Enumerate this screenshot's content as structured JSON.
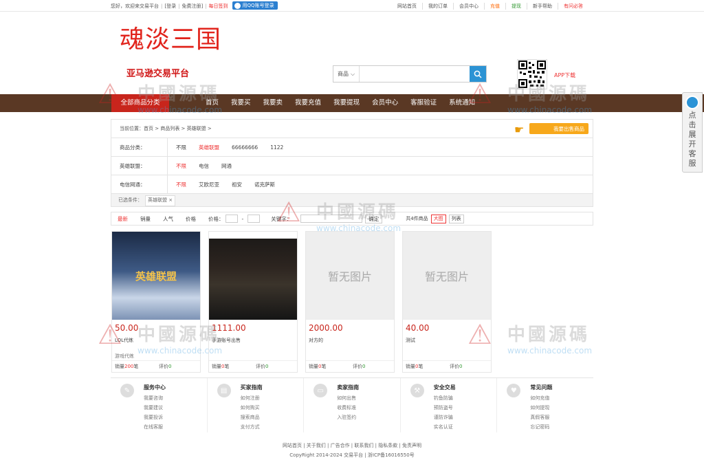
{
  "topbar": {
    "welcome": "您好，欢迎来交易平台",
    "login": "[登录",
    "register": "免费注册]",
    "signin": "每日签到",
    "qq_login": "用QQ账号登录",
    "links": [
      "网站首页",
      "我的订单",
      "会员中心",
      "充值",
      "提现",
      "新手帮助",
      "有问必答"
    ]
  },
  "brand": {
    "logo": "魂淡三国",
    "slogan": "亚马逊交易平台",
    "app_download": "APP下载"
  },
  "search": {
    "select_label": "商品",
    "placeholder": ""
  },
  "nav": {
    "items": [
      "全部商品分类",
      "首页",
      "我要买",
      "我要卖",
      "我要充值",
      "我要提现",
      "会员中心",
      "客服验证",
      "系统通知"
    ]
  },
  "crumb": {
    "text": "当前位置：首页 > 商品列表 > 英雄联盟 >",
    "sell_btn": "我要出售商品"
  },
  "filters": [
    {
      "label": "商品分类：",
      "values": [
        "不限",
        "英雄联盟",
        "66666666",
        "1122"
      ],
      "active": 1
    },
    {
      "label": "英雄联盟：",
      "values": [
        "不限",
        "电信",
        "网通"
      ],
      "active": 0
    },
    {
      "label": "电信网通：",
      "values": [
        "不限",
        "艾欧尼亚",
        "祖安",
        "诺克萨斯"
      ],
      "active": 0
    }
  ],
  "chosen": {
    "label": "已选条件：",
    "tag": "英雄联盟 ×"
  },
  "sort": {
    "items": [
      "最新",
      "销量",
      "人气",
      "价格"
    ],
    "price_label": "价格：",
    "dash": "-",
    "keyword_label": "关键字：",
    "confirm": "确定",
    "total_label": "共4件商品",
    "view_grid": "大图",
    "view_list": "列表"
  },
  "products": [
    {
      "price": "50.00",
      "title": "LOL代练",
      "sub": "游戏代练",
      "sales": "200",
      "rating": "0",
      "img": "英雄联盟"
    },
    {
      "price": "1111.00",
      "title": "手游账号出售",
      "sub": "",
      "sales": "0",
      "rating": "0",
      "img": ""
    },
    {
      "price": "2000.00",
      "title": "对方的",
      "sub": "",
      "sales": "0",
      "rating": "0",
      "img": "暂无图片"
    },
    {
      "price": "40.00",
      "title": "测试",
      "sub": "",
      "sales": "0",
      "rating": "0",
      "img": "暂无图片"
    }
  ],
  "labels": {
    "sales": "销量",
    "sales_unit": "笔",
    "rating": "评价"
  },
  "footer": [
    {
      "title": "服务中心",
      "links": [
        "我要咨询",
        "我要建议",
        "我要投诉",
        "在线客服"
      ]
    },
    {
      "title": "买家指南",
      "links": [
        "如何注册",
        "如何购买",
        "搜索商品",
        "支付方式"
      ]
    },
    {
      "title": "卖家指南",
      "links": [
        "如何出售",
        "收费标准",
        "入驻签约"
      ]
    },
    {
      "title": "安全交易",
      "links": [
        "钓鱼防骗",
        "预防盗号",
        "谨防诈骗",
        "实名认证"
      ]
    },
    {
      "title": "常见问题",
      "links": [
        "如何充值",
        "如何提现",
        "真假客服",
        "忘记密码"
      ]
    }
  ],
  "bottom": {
    "links": "网站首页 | 关于我们 | 广告合作 | 联系我们 | 隐私条款 | 免责声明",
    "copyright": "CopyRight 2014-2024 交易平台 | 浙ICP备16016550号"
  },
  "side": {
    "text": "点击展开客服"
  },
  "watermark": {
    "cn": "中國源碼",
    "en": "www.chinacode.com"
  }
}
